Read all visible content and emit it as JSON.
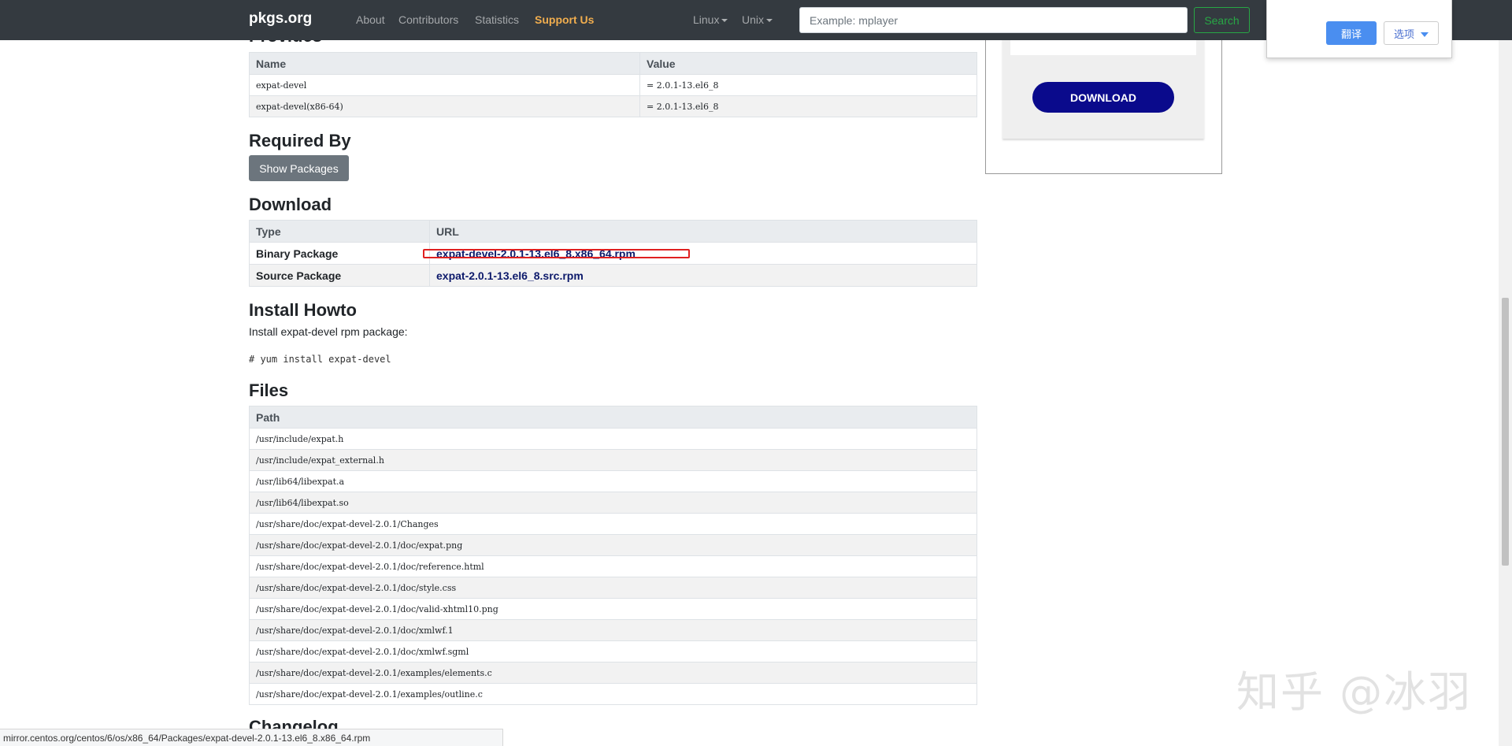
{
  "navbar": {
    "brand": "pkgs.org",
    "links": [
      "About",
      "Contributors",
      "Statistics"
    ],
    "support": "Support Us",
    "dropdowns": [
      "Linux",
      "Unix"
    ],
    "search_placeholder": "Example: mplayer",
    "search_button": "Search"
  },
  "provides": {
    "title": "Provides",
    "columns": [
      "Name",
      "Value"
    ],
    "rows": [
      [
        "expat-devel",
        "= 2.0.1-13.el6_8"
      ],
      [
        "expat-devel(x86-64)",
        "= 2.0.1-13.el6_8"
      ]
    ]
  },
  "required_by": {
    "title": "Required By",
    "button": "Show Packages"
  },
  "download": {
    "title": "Download",
    "columns": [
      "Type",
      "URL"
    ],
    "rows": [
      {
        "type": "Binary Package",
        "url": "expat-devel-2.0.1-13.el6_8.x86_64.rpm"
      },
      {
        "type": "Source Package",
        "url": "expat-2.0.1-13.el6_8.src.rpm"
      }
    ]
  },
  "install": {
    "title": "Install Howto",
    "text": "Install expat-devel rpm package:",
    "command": "# yum install expat-devel"
  },
  "files": {
    "title": "Files",
    "column": "Path",
    "paths": [
      "/usr/include/expat.h",
      "/usr/include/expat_external.h",
      "/usr/lib64/libexpat.a",
      "/usr/lib64/libexpat.so",
      "/usr/share/doc/expat-devel-2.0.1/Changes",
      "/usr/share/doc/expat-devel-2.0.1/doc/expat.png",
      "/usr/share/doc/expat-devel-2.0.1/doc/reference.html",
      "/usr/share/doc/expat-devel-2.0.1/doc/style.css",
      "/usr/share/doc/expat-devel-2.0.1/doc/valid-xhtml10.png",
      "/usr/share/doc/expat-devel-2.0.1/doc/xmlwf.1",
      "/usr/share/doc/expat-devel-2.0.1/doc/xmlwf.sgml",
      "/usr/share/doc/expat-devel-2.0.1/examples/elements.c",
      "/usr/share/doc/expat-devel-2.0.1/examples/outline.c"
    ]
  },
  "changelog": {
    "title": "Changelog"
  },
  "ad": {
    "button": "DOWNLOAD"
  },
  "translate_popup": {
    "translate": "翻译",
    "options": "选项"
  },
  "status_bar": {
    "url": "mirror.centos.org/centos/6/os/x86_64/Packages/expat-devel-2.0.1-13.el6_8.x86_64.rpm"
  },
  "watermark": "知乎 @冰羽",
  "colors": {
    "navbar": "#343a40",
    "support": "#f0ad4e",
    "search": "#28a745",
    "download_btn": "#0a0a8c",
    "highlight": "#e02020",
    "link": "#0d1a6b"
  }
}
